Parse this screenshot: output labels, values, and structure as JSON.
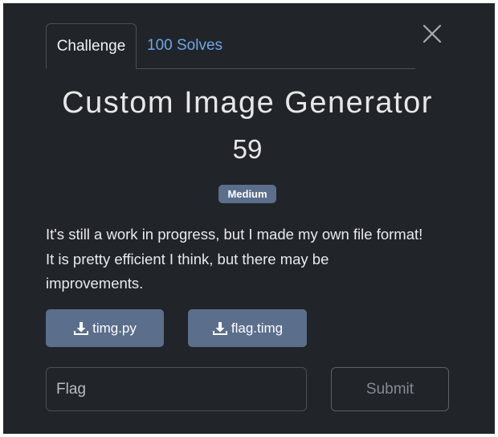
{
  "tabs": {
    "challenge_label": "Challenge",
    "solves_label": "100 Solves"
  },
  "challenge": {
    "title": "Custom Image Generator",
    "points": "59",
    "difficulty": "Medium",
    "description_lines": [
      "It's still a work in progress, but I made my own file format!",
      "It is pretty efficient I think, but there may be",
      "improvements."
    ]
  },
  "files": [
    {
      "name": "timg.py",
      "icon": "download-icon"
    },
    {
      "name": "flag.timg",
      "icon": "download-icon"
    }
  ],
  "form": {
    "flag_placeholder": "Flag",
    "flag_value": "",
    "submit_label": "Submit"
  },
  "icons": {
    "close": "close-icon",
    "download": "download-icon"
  },
  "colors": {
    "background": "#212429",
    "accent_link": "#6ea6e6",
    "button": "#5b6e8c",
    "text": "#e6e7e9"
  }
}
